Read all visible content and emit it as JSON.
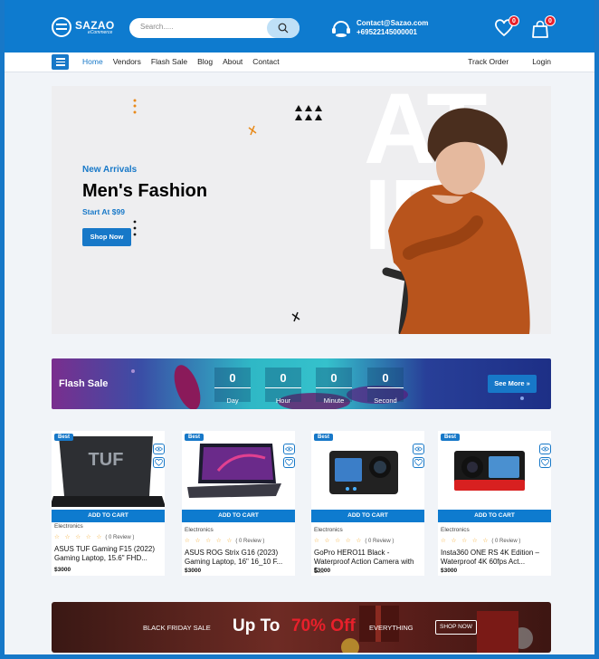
{
  "header": {
    "logo_name": "SAZAO",
    "logo_sub": "eCommerce",
    "search_placeholder": "Search.....",
    "contact_email": "Contact@Sazao.com",
    "contact_phone": "+69522145000001",
    "wishlist_count": "0",
    "cart_count": "0"
  },
  "nav": {
    "links": [
      "Home",
      "Vendors",
      "Flash Sale",
      "Blog",
      "About",
      "Contact"
    ],
    "active": "Home",
    "track_order": "Track Order",
    "login": "Login"
  },
  "hero": {
    "tag": "New Arrivals",
    "title": "Men's Fashion",
    "price": "Start At $99",
    "button": "Shop Now"
  },
  "flash_sale": {
    "label": "Flash Sale",
    "countdown": [
      {
        "value": "0",
        "label": "Day"
      },
      {
        "value": "0",
        "label": "Hour"
      },
      {
        "value": "0",
        "label": "Minute"
      },
      {
        "value": "0",
        "label": "Second"
      }
    ],
    "button": "See More »"
  },
  "products": [
    {
      "badge": "Best",
      "category": "Electronics",
      "stars": "☆ ☆ ☆ ☆ ☆",
      "reviews": "( 0 Review )",
      "name": "ASUS TUF Gaming F15 (2022) Gaming Laptop, 15.6\" FHD...",
      "price": "$3000",
      "add_to_cart": "ADD TO CART",
      "image_logo": "TUF"
    },
    {
      "badge": "Best",
      "category": "Electronics",
      "stars": "☆ ☆ ☆ ☆ ☆",
      "reviews": "( 0 Review )",
      "name": "ASUS ROG Strix G16 (2023) Gaming Laptop, 16\" 16_10 F...",
      "price": "$3000",
      "add_to_cart": "ADD TO CART"
    },
    {
      "badge": "Best",
      "category": "Electronics",
      "stars": "☆ ☆ ☆ ☆ ☆",
      "reviews": "( 0 Review )",
      "name": "GoPro HERO11 Black - Waterproof Action Camera with 5...",
      "price": "$3000",
      "add_to_cart": "ADD TO CART"
    },
    {
      "badge": "Best",
      "category": "Electronics",
      "stars": "☆ ☆ ☆ ☆ ☆",
      "reviews": "( 0 Review )",
      "name": "Insta360 ONE RS 4K Edition – Waterproof 4K 60fps Act...",
      "price": "$3000",
      "add_to_cart": "ADD TO CART"
    }
  ],
  "black_friday": {
    "text": "BLACK FRIDAY SALE",
    "up_to": "Up To",
    "off": "70% Off",
    "everything": "EVERYTHING",
    "button": "SHOP NOW"
  },
  "colors": {
    "primary": "#0e7bcf",
    "badge_red": "#e8202b",
    "star": "#f4a623"
  },
  "icons": [
    "search-icon",
    "headset-icon",
    "heart-icon",
    "cart-icon",
    "menu-icon",
    "eye-icon",
    "wishlist-icon"
  ]
}
